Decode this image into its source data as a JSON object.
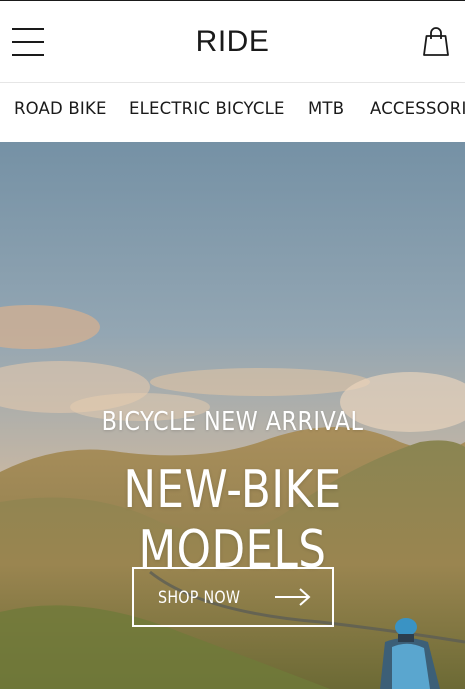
{
  "header": {
    "logo": "RIDE",
    "menu_icon": "hamburger-menu-icon",
    "cart_icon": "shopping-bag-icon"
  },
  "nav": {
    "items": [
      {
        "label": "ROAD BIKE"
      },
      {
        "label": "ELECTRIC BICYCLE"
      },
      {
        "label": "MTB"
      },
      {
        "label": "ACCESSORIES"
      }
    ]
  },
  "hero": {
    "subtitle": "BICYCLE NEW ARRIVAL",
    "title": "NEW-BIKE MODELS",
    "cta_label": "SHOP NOW",
    "cta_icon": "arrow-right-icon"
  },
  "colors": {
    "text": "#1a1a1a",
    "hero_text": "#ffffff",
    "divider": "#e6e6e6"
  }
}
